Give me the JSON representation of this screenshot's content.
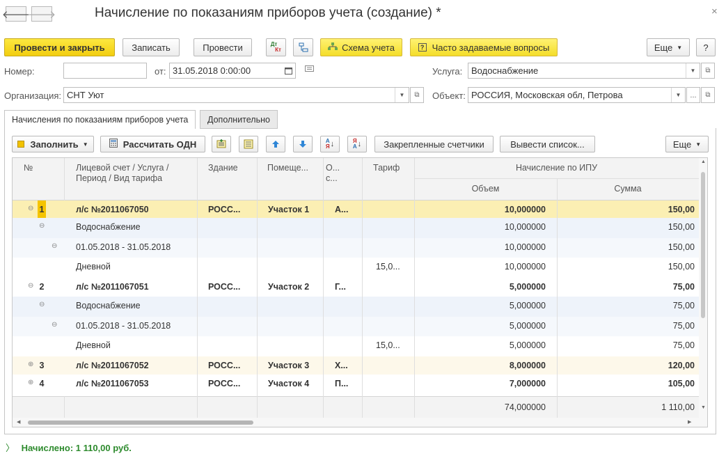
{
  "window": {
    "title": "Начисление по показаниям приборов учета (создание) *",
    "close_glyph": "×"
  },
  "nav": {
    "back_glyph": "🡐",
    "forward_glyph": "🡒"
  },
  "toolbar": {
    "post_close": "Провести и закрыть",
    "save": "Записать",
    "post": "Провести",
    "dt_kt_top": "Дт",
    "dt_kt_bottom": "Кт",
    "scheme": "Схема учета",
    "faq": "Часто задаваемые вопросы",
    "more": "Еще",
    "help": "?"
  },
  "form": {
    "number_label": "Номер:",
    "number_value": "",
    "date_label": "от:",
    "date_value": "31.05.2018  0:00:00",
    "service_label": "Услуга:",
    "service_value": "Водоснабжение",
    "org_label": "Организация:",
    "org_value": "СНТ Уют",
    "object_label": "Объект:",
    "object_value": "РОССИЯ, Московская обл, Петрова",
    "more_dots": "..."
  },
  "tabs": [
    {
      "label": "Начисления по показаниям приборов учета"
    },
    {
      "label": "Дополнительно"
    }
  ],
  "table_toolbar": {
    "fill": "Заполнить",
    "calc_odn": "Рассчитать ОДН",
    "fixed_meters": "Закрепленные счетчики",
    "print_list": "Вывести список...",
    "more": "Еще",
    "sort_asc_top": "А",
    "sort_asc_bottom": "Я",
    "sort_desc_top": "Я",
    "sort_desc_bottom": "А"
  },
  "table": {
    "headers": {
      "num": "№",
      "account_line1": "Лицевой счет / Услуга /",
      "account_line2": "Период / Вид тарифа",
      "building": "Здание",
      "room": "Помеще...",
      "o_line1": "О...",
      "o_line2": "с...",
      "tariff": "Тариф",
      "ipu": "Начисление по ИПУ",
      "volume": "Объем",
      "sum": "Сумма"
    },
    "rows": [
      {
        "toggle": "⊖",
        "num": "1",
        "name": "л/с №2011067050",
        "building": "РОСС...",
        "room": "Участок 1",
        "o": "А...",
        "tariff": "",
        "volume": "10,000000",
        "sum": "150,00"
      },
      {
        "toggle": "⊖",
        "num": "",
        "name": "Водоснабжение",
        "building": "",
        "room": "",
        "o": "",
        "tariff": "",
        "volume": "10,000000",
        "sum": "150,00"
      },
      {
        "toggle": "⊖",
        "num": "",
        "name": "01.05.2018 - 31.05.2018",
        "building": "",
        "room": "",
        "o": "",
        "tariff": "",
        "volume": "10,000000",
        "sum": "150,00"
      },
      {
        "toggle": "",
        "num": "",
        "name": "Дневной",
        "building": "",
        "room": "",
        "o": "",
        "tariff": "15,0...",
        "volume": "10,000000",
        "sum": "150,00"
      },
      {
        "toggle": "⊖",
        "num": "2",
        "name": "л/с №2011067051",
        "building": "РОСС...",
        "room": "Участок 2",
        "o": "Г...",
        "tariff": "",
        "volume": "5,000000",
        "sum": "75,00"
      },
      {
        "toggle": "⊖",
        "num": "",
        "name": "Водоснабжение",
        "building": "",
        "room": "",
        "o": "",
        "tariff": "",
        "volume": "5,000000",
        "sum": "75,00"
      },
      {
        "toggle": "⊖",
        "num": "",
        "name": "01.05.2018 - 31.05.2018",
        "building": "",
        "room": "",
        "o": "",
        "tariff": "",
        "volume": "5,000000",
        "sum": "75,00"
      },
      {
        "toggle": "",
        "num": "",
        "name": "Дневной",
        "building": "",
        "room": "",
        "o": "",
        "tariff": "15,0...",
        "volume": "5,000000",
        "sum": "75,00"
      },
      {
        "toggle": "⊕",
        "num": "3",
        "name": "л/с №2011067052",
        "building": "РОСС...",
        "room": "Участок 3",
        "o": "Х...",
        "tariff": "",
        "volume": "8,000000",
        "sum": "120,00"
      },
      {
        "toggle": "⊕",
        "num": "4",
        "name": "л/с №2011067053",
        "building": "РОСС...",
        "room": "Участок 4",
        "o": "П...",
        "tariff": "",
        "volume": "7,000000",
        "sum": "105,00"
      }
    ],
    "totals": {
      "volume": "74,000000",
      "sum": "1 110,00"
    }
  },
  "status": {
    "text": "Начислено: 1 110,00 руб.",
    "chevron": "〉"
  },
  "colors": {
    "selected_row": "#fbefb3",
    "service_row": "#eef3fa",
    "period_row": "#f5f8fc",
    "account_row": "#fdf8ea",
    "status_green": "#2e8b2e"
  }
}
